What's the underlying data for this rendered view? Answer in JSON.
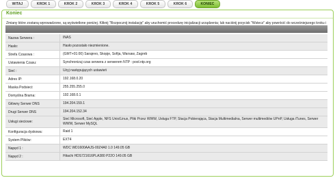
{
  "tabs": [
    "WITAJ",
    "KROK 1",
    "KROK 2",
    "KROK 3",
    "KROK 4",
    "KROK 5",
    "KROK 6",
    "KONIEC"
  ],
  "active_tab": "KONIEC",
  "panel": {
    "title": "Koniec",
    "intro": "Zmiany które zostaną wprowadzone, są wyświetlone poniżej. Kliknij \"Rozpocznij instalację\" aby uruchomić procedurę inicjalizacji urządzenia; lub naciśnij przycisk \"Wstecz\" aby powrócić do wcześniejszego kroku i zmienić ustawienia."
  },
  "rows": [
    {
      "label": "Nazwa Serwera :",
      "value": "INAS"
    },
    {
      "label": "Hasło:",
      "value": "Hasło pozostało niezmienione."
    },
    {
      "label": "Strefa Czasowa :",
      "value": "(GMT+01:00) Sarajevo, Skopje, Sofija, Warsaw, Zagreb"
    },
    {
      "label": "Ustawienia Czasu:",
      "value": "Synchronizuj czas serwera z serwerem NTP : pool.ntp.org"
    },
    {
      "label": "Sieć :",
      "value": "Użyj następujących ustawień"
    },
    {
      "label": "Adres IP:",
      "value": "192.168.0.20"
    },
    {
      "label": "Maska Podsieci:",
      "value": "255.255.255.0"
    },
    {
      "label": "Domyślna Brama:",
      "value": "192.168.0.1"
    },
    {
      "label": "Główny Serwer DNS",
      "value": "194.204.159.1"
    },
    {
      "label": "Drugi Serwer DNS",
      "value": "194.204.152.34"
    },
    {
      "label": "Usługi sieciowe:",
      "value": "Sieć Microsoft,   Sieć Apple,   NFS Unix/Linux,   Pliki Przez WWW,   Usługa FTP,   Stacja Pobierająca,   Stacja Multimedialna,   Serwer multimediów UPnP,   Usługa iTunes,   Serwer WWW,   Serwer MySQL"
    },
    {
      "label": "Konfiguracja dyskowa:",
      "value": "Raid 1"
    },
    {
      "label": "System Plików:",
      "value": "EXT4"
    },
    {
      "label": "Napęd 1 :",
      "value": "WDC WD1600AAJS-00Z4A0 1.0 149.05 GB"
    },
    {
      "label": "Napęd 2 :",
      "value": "Hitachi HDS721616PLA380 P22O 149.05 GB"
    }
  ]
}
